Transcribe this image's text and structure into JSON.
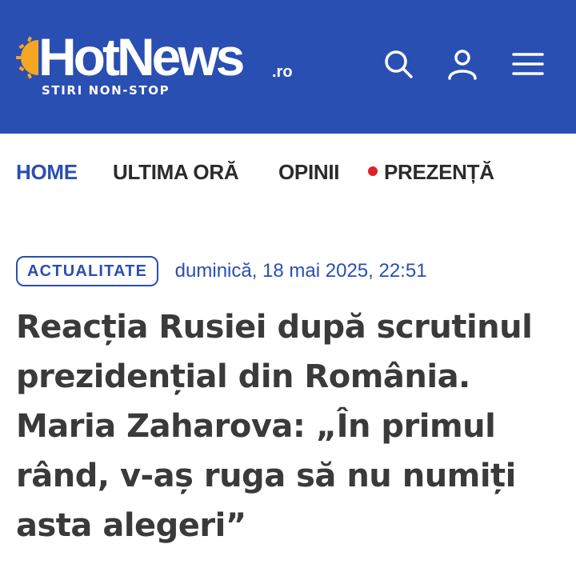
{
  "header": {
    "logo_text": "HotNews",
    "logo_tld": ".ro",
    "tagline": "STIRI NON-STOP",
    "brand_color": "#2a4fb2",
    "icons": [
      "search-icon",
      "user-icon",
      "menu-icon"
    ]
  },
  "nav": {
    "items": [
      {
        "label": "HOME",
        "active": true
      },
      {
        "label": "ULTIMA ORĂ",
        "active": false
      },
      {
        "label": "OPINII",
        "active": false
      },
      {
        "label": "PREZENȚĂ",
        "active": false,
        "live_indicator_color": "#e0202a"
      }
    ]
  },
  "article": {
    "category": "ACTUALITATE",
    "date": "duminică, 18 mai 2025, 22:51",
    "title": "Reacția Rusiei după scrutinul prezidențial din România. Maria Zaharova: „În primul rând, v-aș ruga să nu numiți asta alegeri”"
  }
}
